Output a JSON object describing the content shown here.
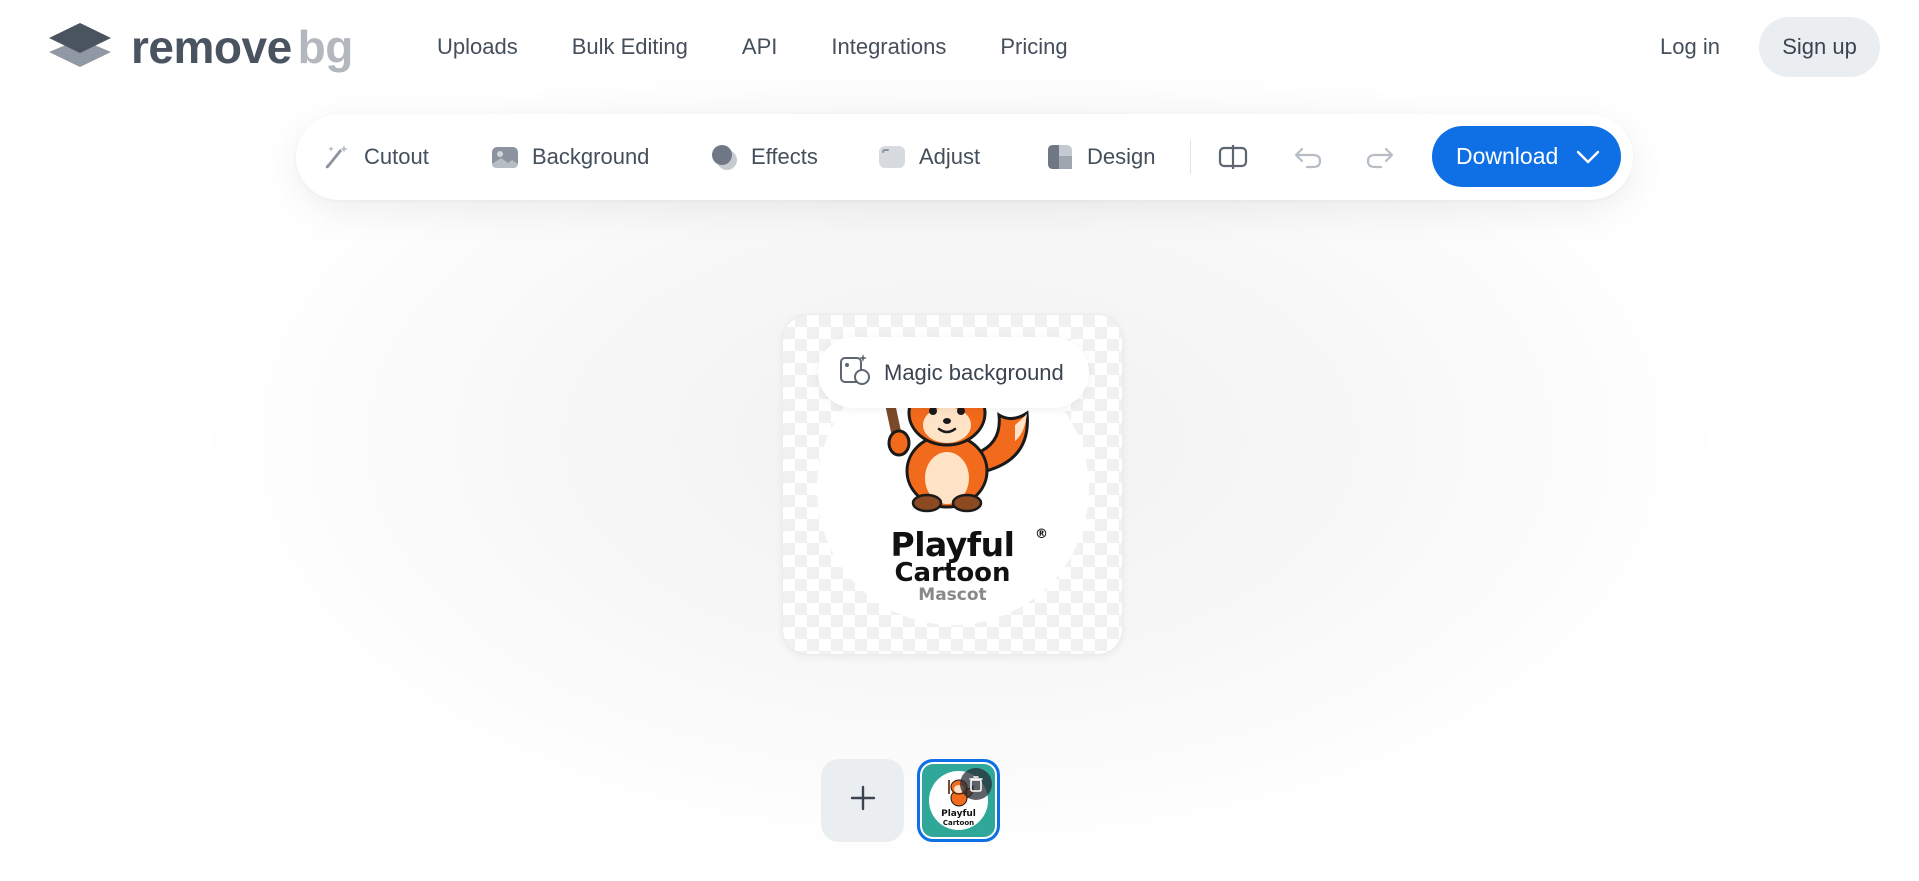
{
  "brand": {
    "logo_word_1": "remove",
    "logo_word_2": "bg",
    "logo_icon": "layers-diamond-icon"
  },
  "nav": {
    "items": [
      {
        "label": "Uploads"
      },
      {
        "label": "Bulk Editing"
      },
      {
        "label": "API"
      },
      {
        "label": "Integrations"
      },
      {
        "label": "Pricing"
      }
    ],
    "login_label": "Log in",
    "signup_label": "Sign up"
  },
  "toolbar": {
    "tools": [
      {
        "label": "Cutout",
        "icon": "magic-brush-icon"
      },
      {
        "label": "Background",
        "icon": "image-icon"
      },
      {
        "label": "Effects",
        "icon": "shadow-circles-icon"
      },
      {
        "label": "Adjust",
        "icon": "adjust-square-icon"
      },
      {
        "label": "Design",
        "icon": "design-layout-icon"
      }
    ],
    "compare_icon": "compare-split-icon",
    "undo_icon": "undo-icon",
    "redo_icon": "redo-icon",
    "download_label": "Download",
    "download_chevron_icon": "chevron-down-icon"
  },
  "preview": {
    "magic_background_label": "Magic background",
    "image_text": {
      "line1": "Playful",
      "registered": "®",
      "line2": "Cartoon",
      "line3": "Mascot"
    }
  },
  "thumbnails": {
    "add_icon": "plus-icon",
    "items": [
      {
        "line1": "Playful",
        "line2": "Cartoon",
        "delete_icon": "trash-icon"
      }
    ]
  },
  "colors": {
    "accent": "#0f70e6",
    "text": "#454f5b",
    "pill_bg": "#ebeef1",
    "thumb_bg": "#2fa89a",
    "fox_orange": "#f26a1b"
  }
}
